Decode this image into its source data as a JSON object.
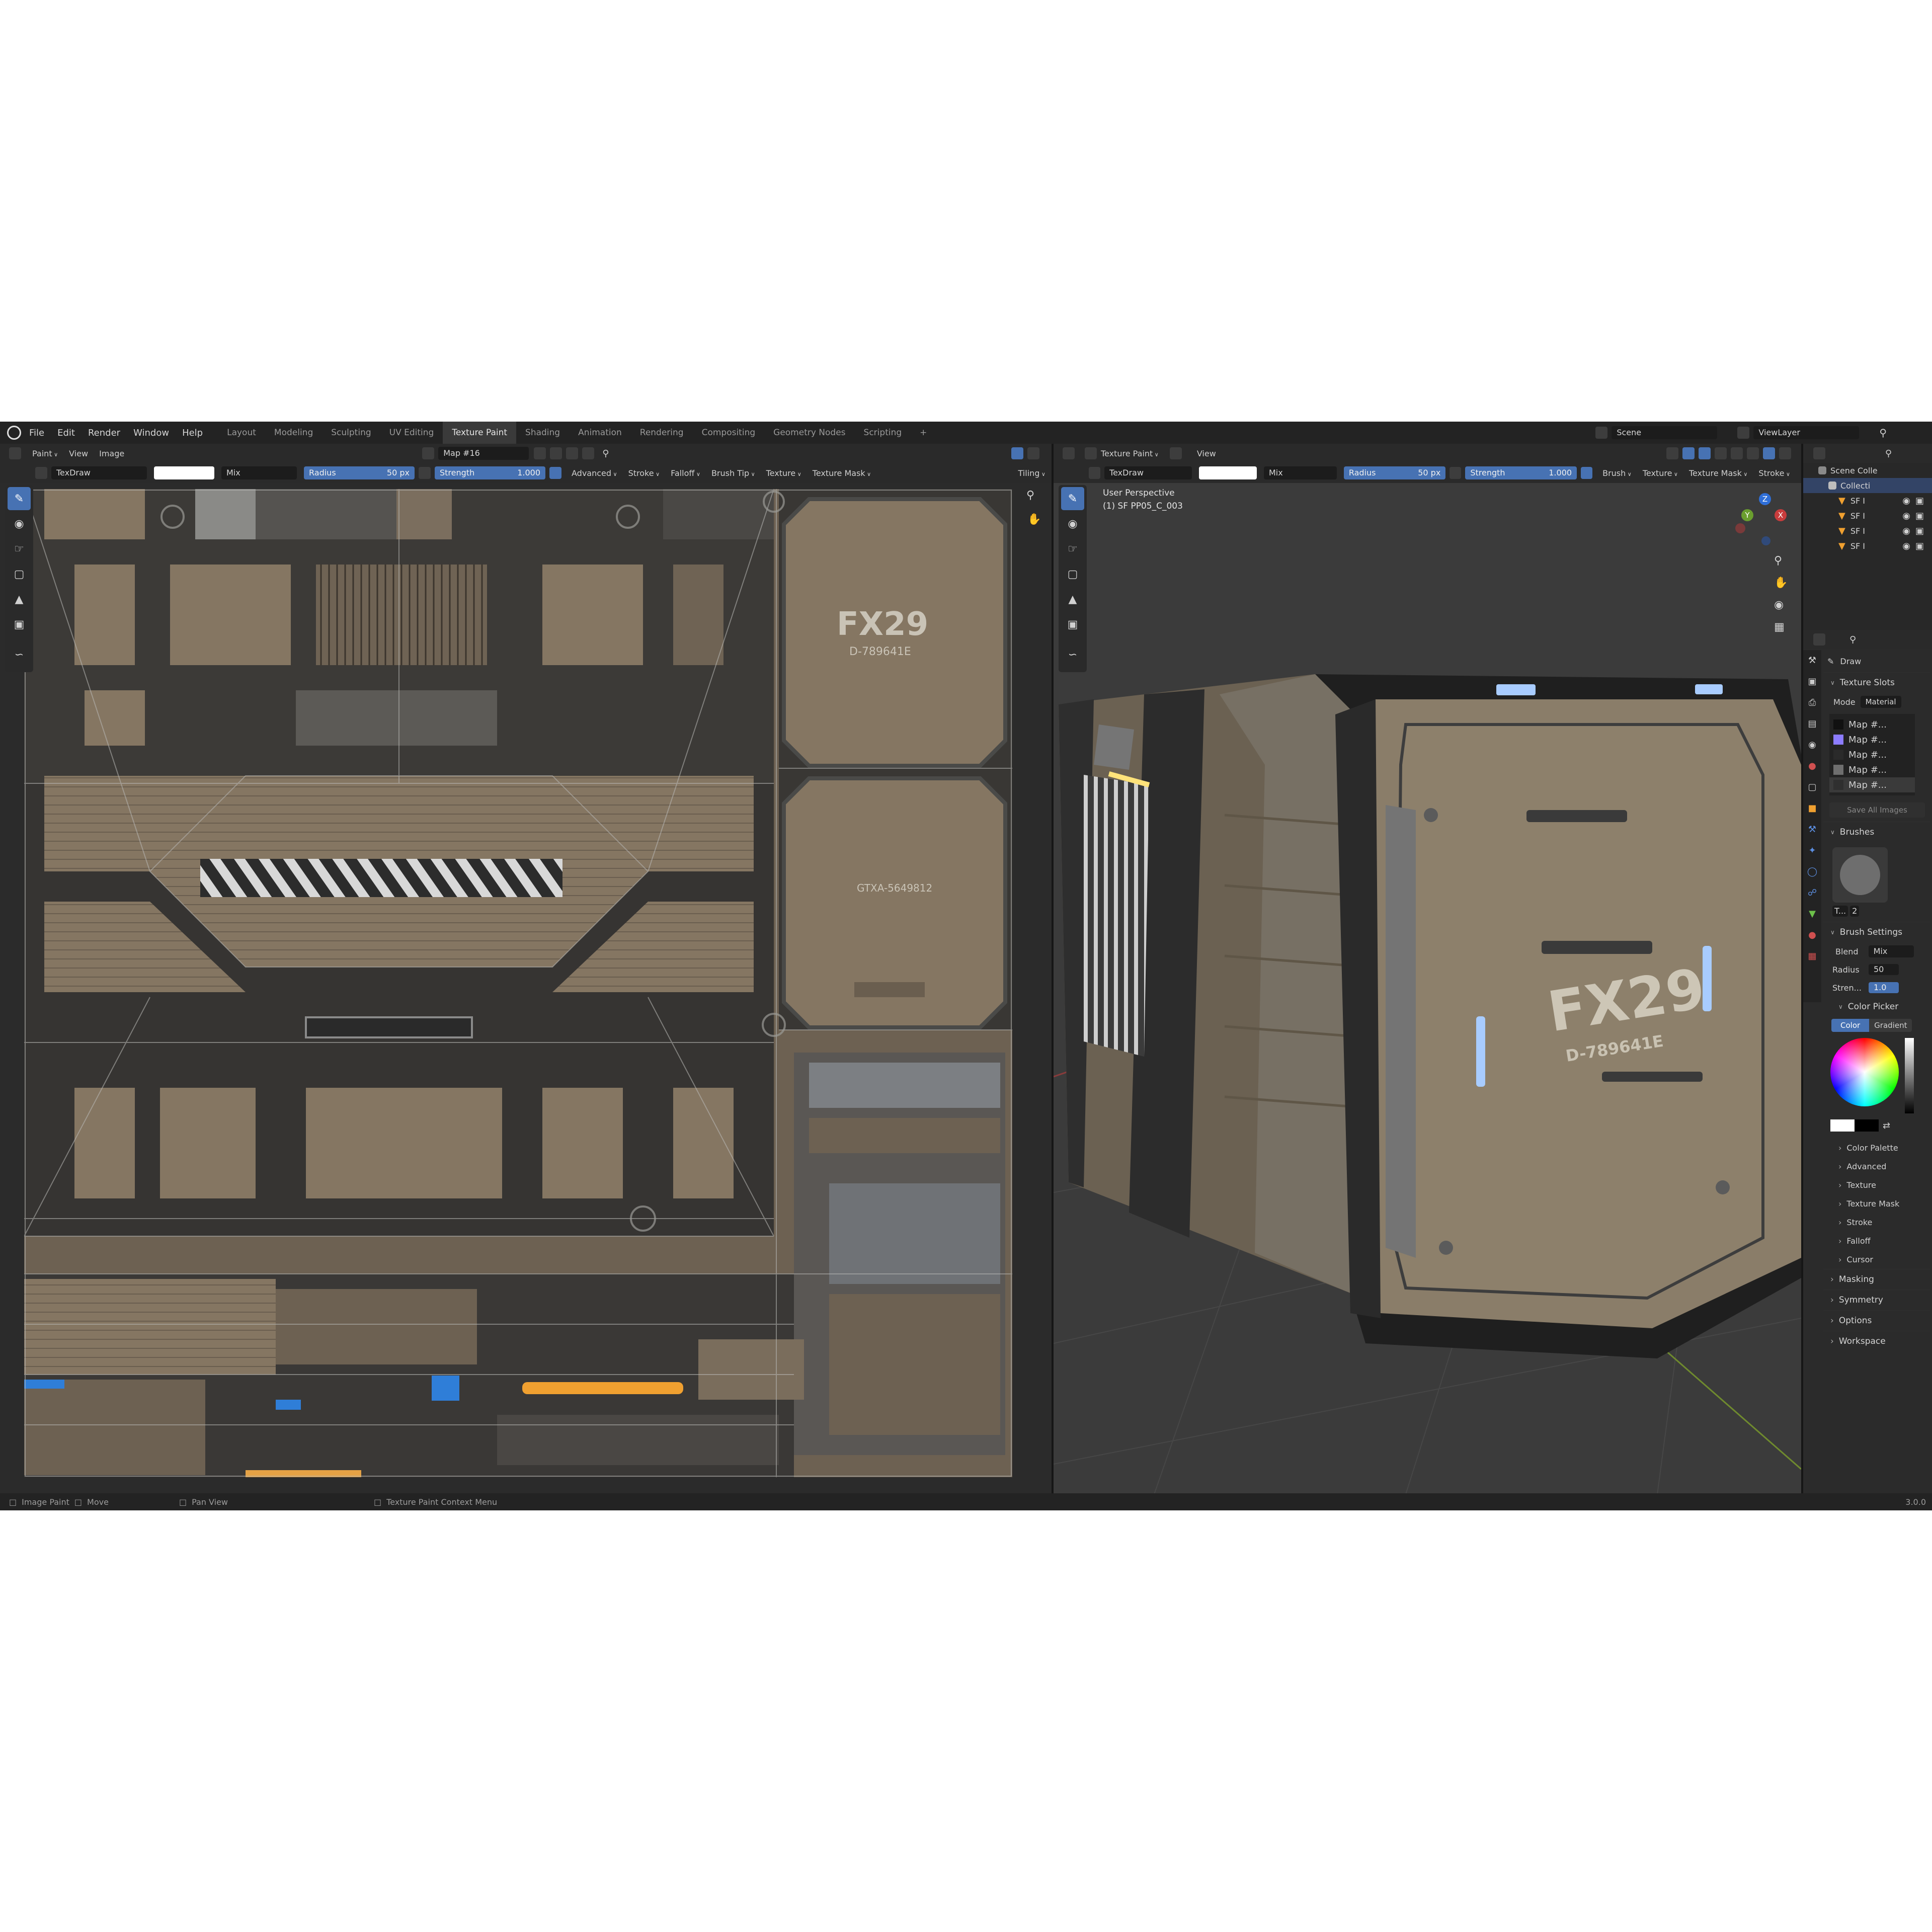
{
  "menu": [
    "File",
    "Edit",
    "Render",
    "Window",
    "Help"
  ],
  "workspaces": [
    "Layout",
    "Modeling",
    "Sculpting",
    "UV Editing",
    "Texture Paint",
    "Shading",
    "Animation",
    "Rendering",
    "Compositing",
    "Geometry Nodes",
    "Scripting"
  ],
  "active_workspace": "Texture Paint",
  "add_workspace": "+",
  "scene_name": "Scene",
  "view_layer": "ViewLayer",
  "image_editor": {
    "mode": "Paint",
    "menus": [
      "View",
      "Image"
    ],
    "image_name": "Map #16",
    "brush": "TexDraw",
    "blend": "Mix",
    "radius_label": "Radius",
    "radius_value": "50 px",
    "strength_label": "Strength",
    "strength_value": "1.000",
    "popovers": [
      "Advanced",
      "Stroke",
      "Falloff",
      "Brush Tip",
      "Texture",
      "Texture Mask"
    ],
    "tiling": "Tiling",
    "uv_texts": [
      "FX29",
      "D-789641E",
      "GTXA-5649812"
    ]
  },
  "viewport": {
    "mode": "Texture Paint",
    "menus": [
      "View"
    ],
    "brush": "TexDraw",
    "blend": "Mix",
    "radius_label": "Radius",
    "radius_value": "50 px",
    "strength_label": "Strength",
    "strength_value": "1.000",
    "popovers": [
      "Brush",
      "Texture",
      "Texture Mask",
      "Stroke"
    ],
    "overlay_line1": "User Perspective",
    "overlay_line2": "(1) SF PP05_C_003",
    "crate_text": "FX29",
    "crate_id": "D-789641E",
    "gizmo": {
      "z": "Z",
      "y": "Y",
      "x": "X"
    }
  },
  "outliner": {
    "root": "Scene Colle",
    "collection": "Collecti",
    "items": [
      "SF I",
      "SF I",
      "SF I",
      "SF I"
    ]
  },
  "properties": {
    "brush_name": "Draw",
    "texture_slots": "Texture Slots",
    "mode_label": "Mode",
    "mode_value": "Material",
    "slots": [
      "Map #...",
      "Map #...",
      "Map #...",
      "Map #...",
      "Map #..."
    ],
    "slot_colors": [
      "#111111",
      "#8c7cff",
      "#2a2a2a",
      "#6e6e6e",
      "#2f2f2f"
    ],
    "save_all": "Save All Images",
    "brushes": "Brushes",
    "brush_short": "T...",
    "brush_users": "2",
    "brush_settings": "Brush Settings",
    "blend_label": "Blend",
    "blend_value": "Mix",
    "radius_label": "Radius",
    "radius_value": "50",
    "strength_label": "Stren...",
    "strength_value": "1.0",
    "color_picker": "Color Picker",
    "color_tab": "Color",
    "gradient_tab": "Gradient",
    "subpanels": [
      "Color Palette",
      "Advanced",
      "Texture",
      "Texture Mask",
      "Stroke",
      "Falloff",
      "Cursor"
    ],
    "sections": [
      "Masking",
      "Symmetry",
      "Options",
      "Workspace"
    ]
  },
  "status": {
    "items": [
      "Image Paint",
      "Move",
      "Pan View",
      "Texture Paint Context Menu"
    ],
    "version": "3.0.0"
  }
}
